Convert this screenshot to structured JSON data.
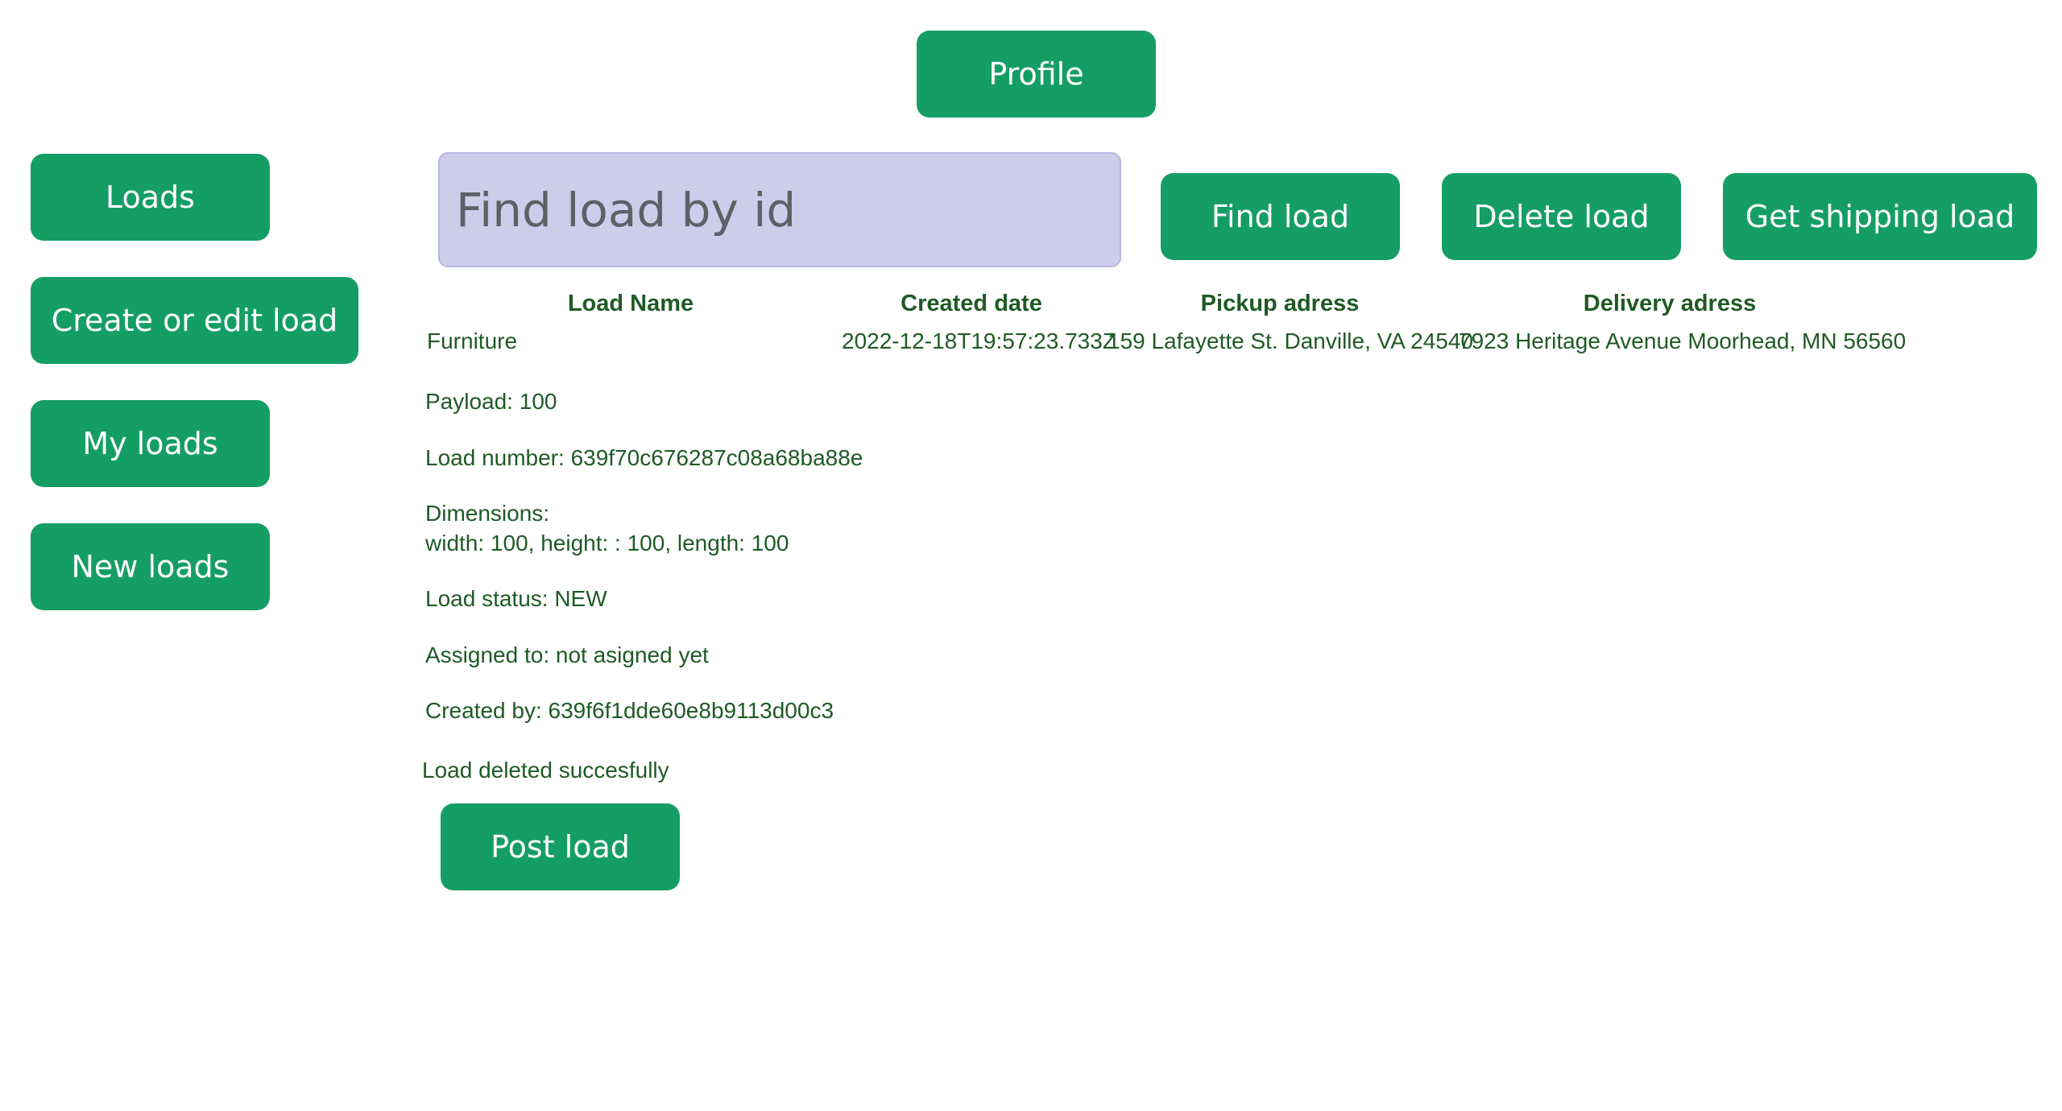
{
  "header": {
    "profile_label": "Profile"
  },
  "sidebar": {
    "items": [
      {
        "label": "Loads"
      },
      {
        "label": "Create or edit load"
      },
      {
        "label": "My loads"
      },
      {
        "label": "New loads"
      }
    ]
  },
  "search": {
    "placeholder": "Find load by id",
    "value": ""
  },
  "actions": {
    "find_label": "Find load",
    "delete_label": "Delete load",
    "shipping_label": "Get shipping load"
  },
  "table": {
    "columns": [
      "Load Name",
      "Created date",
      "Pickup adress",
      "Delivery adress"
    ],
    "row": {
      "name": "Furniture",
      "created": "2022-12-18T19:57:23.733Z",
      "pickup": "159 Lafayette St. Danville, VA 24540",
      "delivery": "7923 Heritage Avenue Moorhead, MN 56560"
    }
  },
  "details": {
    "payload": "Payload: 100",
    "load_number": "Load number: 639f70c676287c08a68ba88e",
    "dimensions_label": "Dimensions:",
    "dimensions_value": "width: 100, height: : 100, length: 100",
    "status": "Load status: NEW",
    "assigned": "Assigned to: not asigned yet",
    "created_by": "Created by: 639f6f1dde60e8b9113d00c3"
  },
  "message": "Load deleted succesfully",
  "post_label": "Post load",
  "colors": {
    "button": "#159e63",
    "text": "#1f5a25",
    "search_bg": "#cdcceb"
  }
}
